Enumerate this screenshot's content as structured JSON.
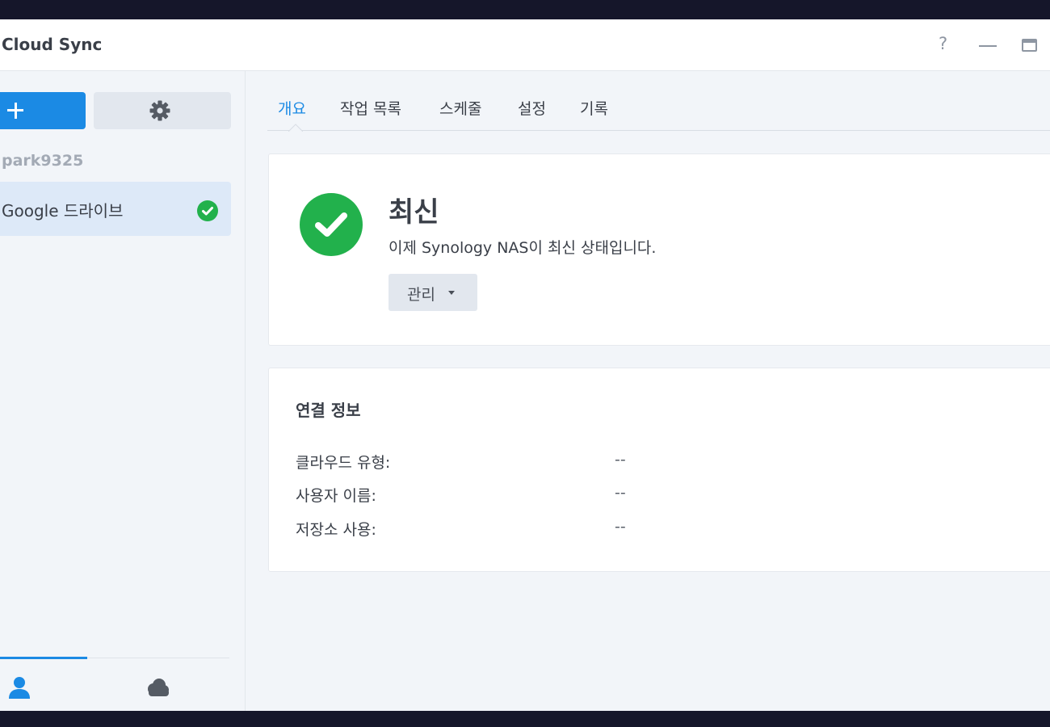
{
  "window": {
    "title": "Cloud Sync"
  },
  "window_controls": {
    "help_label": "?"
  },
  "sidebar": {
    "account": "park9325",
    "connections": [
      {
        "label": "Google 드라이브",
        "status": "up-to-date"
      }
    ]
  },
  "tabs": [
    {
      "label": "개요",
      "active": true
    },
    {
      "label": "작업 목록",
      "active": false
    },
    {
      "label": "스케줄",
      "active": false
    },
    {
      "label": "설정",
      "active": false
    },
    {
      "label": "기록",
      "active": false
    }
  ],
  "status": {
    "title": "최신",
    "description": "이제 Synology NAS이 최신 상태입니다.",
    "manage_label": "관리"
  },
  "connection_info": {
    "title": "연결 정보",
    "rows": [
      {
        "key": "클라우드 유형:",
        "value": "--"
      },
      {
        "key": "사용자 이름:",
        "value": "--"
      },
      {
        "key": "저장소 사용:",
        "value": "--"
      }
    ]
  },
  "icons": {
    "add": "plus-icon",
    "settings": "gear-icon",
    "status_ok": "check-circle-icon",
    "footer_user": "user-icon",
    "footer_cloud": "cloud-icon",
    "help": "help-icon",
    "minimize": "minimize-icon",
    "maximize": "maximize-icon"
  },
  "colors": {
    "accent": "#1b8ae4",
    "success": "#22b14c",
    "selected_bg": "#dde9f8"
  }
}
